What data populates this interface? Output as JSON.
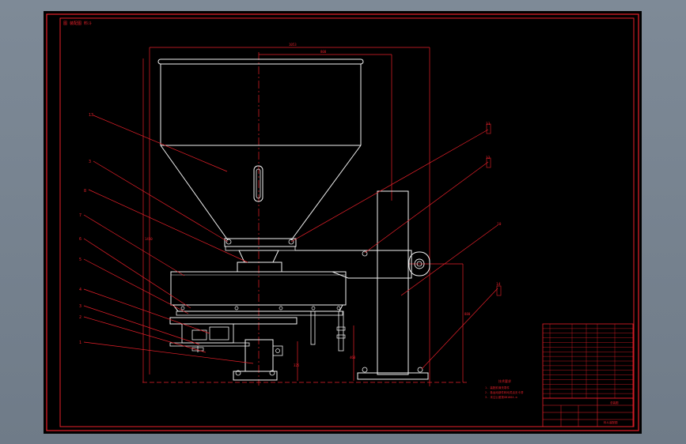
{
  "drawing": {
    "title_block_label": "图 装配图 料斗",
    "dim_overall_width": "1053",
    "dim_hopper_width": "800",
    "dim_height_left": "1450",
    "dim_pillar_height": "880",
    "dim_offset_small": "325",
    "dim_offset_right": "460",
    "part_labels": [
      "13",
      "3",
      "8",
      "7",
      "6",
      "5",
      "4",
      "3",
      "2",
      "1",
      "11",
      "12",
      "10",
      "14"
    ],
    "notes_heading": "技术要求",
    "notes": [
      "1. 装配前清洗零件",
      "2. 各运动部件转动灵活无卡滞",
      "3. 未注公差按GB1804-m"
    ],
    "table_header": "总装图",
    "table_title": "料斗装配图",
    "colors": {
      "frame": "#e8202a",
      "part": "#f2f2f2",
      "sheet": "#000000"
    }
  }
}
